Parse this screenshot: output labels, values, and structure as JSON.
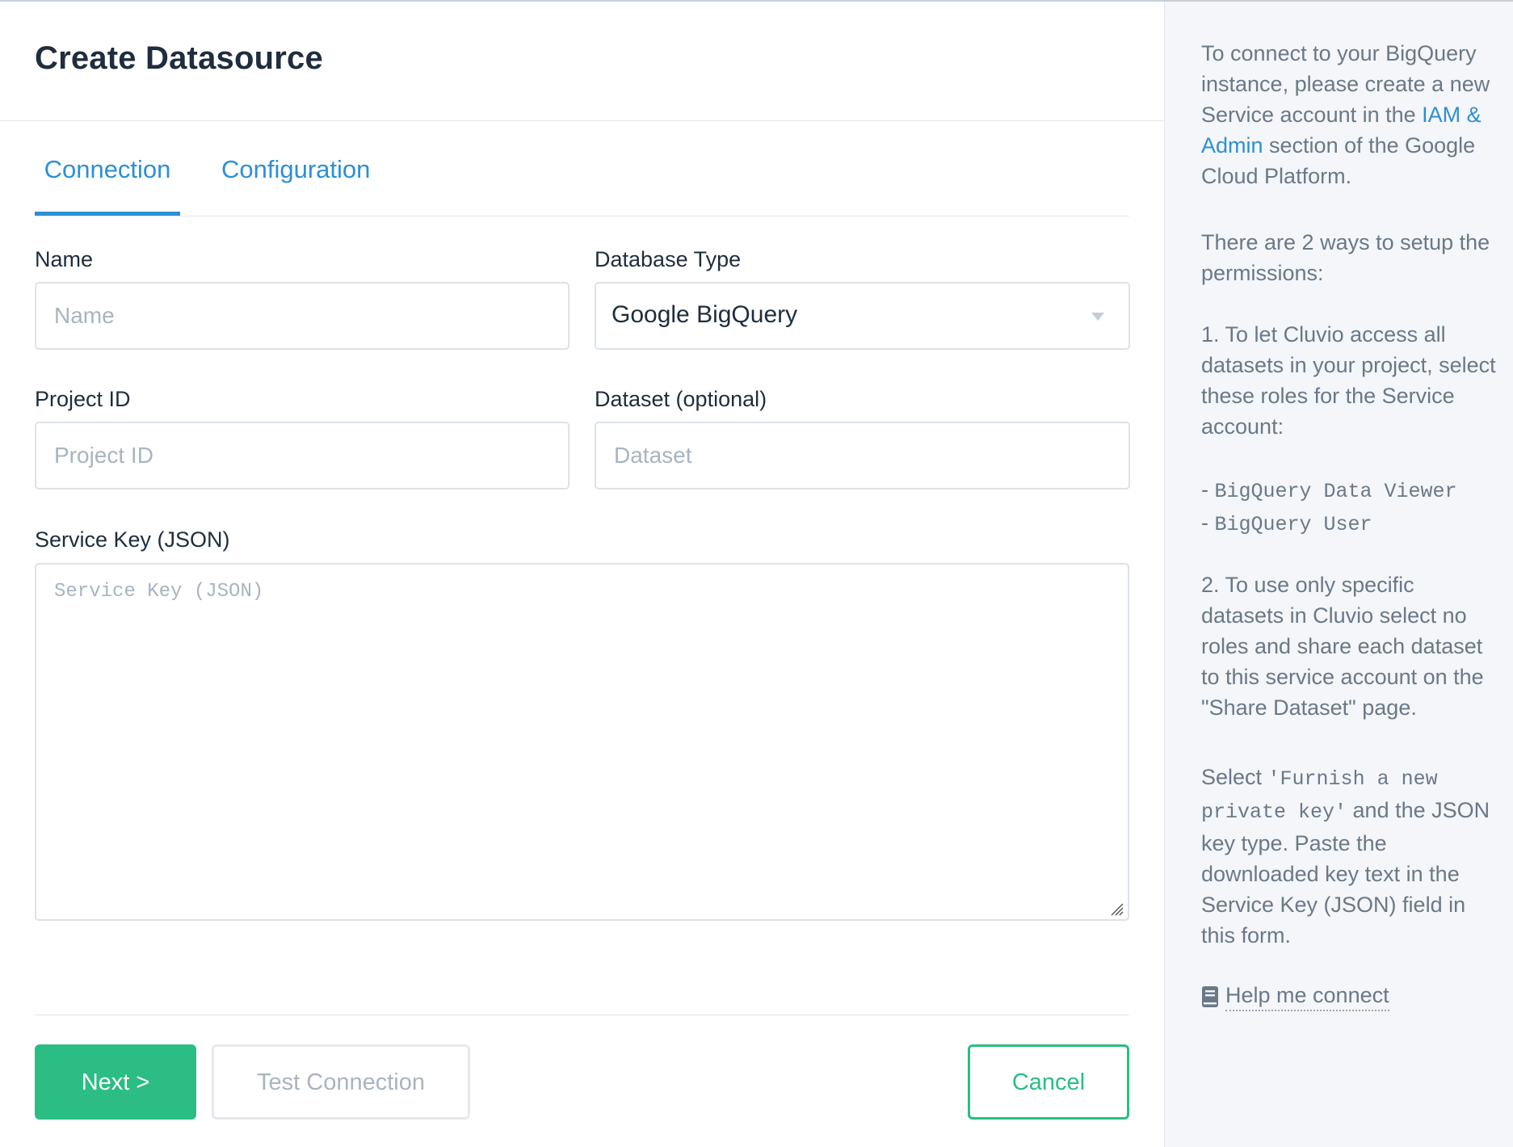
{
  "header": {
    "title": "Create Datasource"
  },
  "tabs": [
    {
      "label": "Connection",
      "active": true
    },
    {
      "label": "Configuration",
      "active": false
    }
  ],
  "form": {
    "name": {
      "label": "Name",
      "placeholder": "Name",
      "value": ""
    },
    "database_type": {
      "label": "Database Type",
      "value": "Google BigQuery"
    },
    "project_id": {
      "label": "Project ID",
      "placeholder": "Project ID",
      "value": ""
    },
    "dataset": {
      "label": "Dataset (optional)",
      "placeholder": "Dataset",
      "value": ""
    },
    "service_key": {
      "label": "Service Key (JSON)",
      "placeholder": "Service Key (JSON)",
      "value": ""
    }
  },
  "actions": {
    "next_label": "Next >",
    "test_label": "Test Connection",
    "cancel_label": "Cancel"
  },
  "sidebar": {
    "intro_before": "To connect to your BigQuery instance, please create a new Service account in the ",
    "iam_link": "IAM & Admin",
    "intro_after": " section of the Google Cloud Platform.",
    "ways": "There are 2 ways to setup the permissions:",
    "option1": "1. To let Cluvio access all datasets in your project, select these roles for the Service account:",
    "role1_prefix": "- ",
    "role1": "BigQuery Data Viewer",
    "role2_prefix": "- ",
    "role2": "BigQuery User",
    "option2": "2. To use only specific datasets in Cluvio select no roles and share each dataset to this service account on the \"Share Dataset\" page.",
    "select_before": "Select ",
    "select_code": "'Furnish a new private key'",
    "select_after": " and the JSON key type. Paste the downloaded key text in the Service Key (JSON) field in this form.",
    "help_connect": "Help me connect"
  },
  "colors": {
    "accent_blue": "#2d8fd5",
    "accent_green": "#2bbd83",
    "sidebar_bg": "#f4f6f9",
    "muted_text": "#6b7888"
  }
}
